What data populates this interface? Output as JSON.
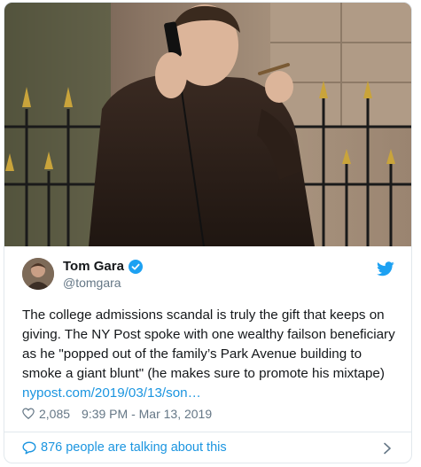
{
  "tweet": {
    "author": {
      "display_name": "Tom Gara",
      "handle": "@tomgara",
      "verified": true,
      "avatar_icon": "avatar-photo"
    },
    "text_before_link": "The college admissions scandal is truly the gift that keeps on giving. The NY Post spoke with one wealthy failson beneficiary as he \"popped out of the family’s Park Avenue building to smoke a giant blunt\" (he makes sure to promote his mixtape) ",
    "link_text": "nypost.com/2019/03/13/son…",
    "likes": "2,085",
    "timestamp": "9:39 PM - Mar 13, 2019",
    "talking_label": "876 people are talking about this"
  },
  "icons": {
    "brand": "twitter-bird-icon",
    "verified": "verified-badge-icon",
    "like": "heart-icon",
    "reply": "speech-bubble-icon",
    "more": "chevron-right-icon"
  },
  "colors": {
    "link": "#1b95e0",
    "secondary_text": "#657786",
    "border": "#e1e8ed",
    "text": "#14171a"
  }
}
